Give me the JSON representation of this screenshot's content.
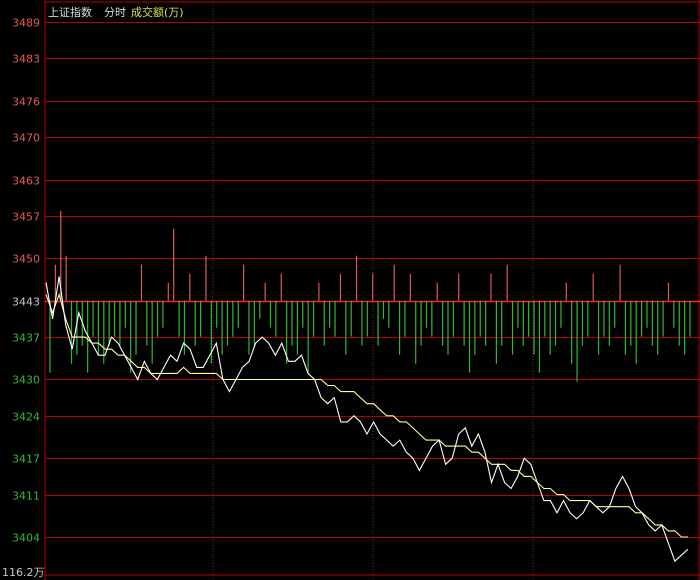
{
  "header": {
    "index_name": "上证指数",
    "mode": "分时",
    "series_label": "成交额(万)"
  },
  "colors": {
    "background": "#000000",
    "grid": "#b30000",
    "up": "#e05a5a",
    "down": "#33b833",
    "axis_neutral": "#c8c8c8",
    "price_line": "#ffffff",
    "avg_line": "#ffff99",
    "header_text": "#dcdcdc",
    "series_text": "#e0e050"
  },
  "chart_data": {
    "type": "line",
    "y_reference": 3443,
    "ylim": [
      3400,
      3490
    ],
    "y_ticks": [
      3489,
      3483,
      3476,
      3470,
      3463,
      3457,
      3450,
      3443,
      3437,
      3430,
      3424,
      3417,
      3411,
      3404
    ],
    "bottom_label": "116.2万",
    "grid": true,
    "series": [
      {
        "role": "price",
        "values": [
          3446,
          3440,
          3447,
          3439,
          3435,
          3441,
          3438,
          3436,
          3434,
          3434,
          3437,
          3436,
          3434,
          3432,
          3430,
          3433,
          3431,
          3430,
          3432,
          3434,
          3433,
          3436,
          3435,
          3432,
          3432,
          3434,
          3436,
          3430,
          3428,
          3430,
          3432,
          3433,
          3436,
          3437,
          3436,
          3434,
          3436,
          3433,
          3433,
          3434,
          3431,
          3430,
          3427,
          3426,
          3427,
          3423,
          3423,
          3424,
          3423,
          3421,
          3423,
          3421,
          3420,
          3419,
          3420,
          3418,
          3417,
          3415,
          3417,
          3419,
          3420,
          3416,
          3417,
          3421,
          3422,
          3419,
          3421,
          3418,
          3413,
          3416,
          3413,
          3412,
          3414,
          3417,
          3416,
          3413,
          3410,
          3410,
          3408,
          3410,
          3408,
          3407,
          3408,
          3410,
          3409,
          3408,
          3409,
          3412,
          3414,
          3412,
          3409,
          3408,
          3406,
          3405,
          3406,
          3403,
          3400,
          3401,
          3402
        ],
        "axis": "price"
      },
      {
        "role": "average",
        "values": [
          3444,
          3441,
          3444,
          3440,
          3437,
          3437,
          3437,
          3436,
          3436,
          3435,
          3435,
          3434,
          3434,
          3433,
          3432,
          3432,
          3431,
          3431,
          3431,
          3431,
          3431,
          3432,
          3431,
          3431,
          3431,
          3431,
          3431,
          3430,
          3430,
          3430,
          3430,
          3430,
          3430,
          3430,
          3430,
          3430,
          3430,
          3430,
          3430,
          3430,
          3430,
          3430,
          3430,
          3429,
          3429,
          3428,
          3428,
          3428,
          3427,
          3426,
          3426,
          3425,
          3424,
          3424,
          3423,
          3423,
          3422,
          3421,
          3420,
          3420,
          3420,
          3419,
          3419,
          3419,
          3419,
          3418,
          3418,
          3417,
          3416,
          3416,
          3416,
          3415,
          3415,
          3414,
          3414,
          3413,
          3412,
          3412,
          3411,
          3411,
          3410,
          3410,
          3410,
          3410,
          3409,
          3409,
          3409,
          3409,
          3409,
          3409,
          3408,
          3408,
          3407,
          3406,
          3406,
          3405,
          3405,
          3404,
          3404
        ],
        "axis": "price"
      },
      {
        "role": "turnover_bars",
        "values": [
          -8,
          4,
          10,
          5,
          -7,
          -6,
          -5,
          -8,
          -4,
          -6,
          -7,
          -5,
          -4,
          -5,
          -3,
          -8,
          -6,
          4,
          -5,
          -7,
          -4,
          -3,
          2,
          8,
          -4,
          -6,
          3,
          -5,
          -4,
          5,
          -7,
          -3,
          -6,
          -5,
          -4,
          -3,
          4,
          -6,
          -5,
          -2,
          2,
          -3,
          -4,
          3,
          -7,
          -5,
          -6,
          -3,
          -8,
          -4,
          2,
          -5,
          -3,
          -4,
          3,
          -6,
          -4,
          5,
          -5,
          -4,
          3,
          -5,
          -2,
          -3,
          4,
          -6,
          -4,
          3,
          -7,
          -5,
          -3,
          -4,
          2,
          -5,
          -6,
          -4,
          3,
          -5,
          -8,
          -6,
          -4,
          -5,
          3,
          -7,
          -5,
          4,
          -6,
          -3,
          -5,
          -4,
          -6,
          -8,
          -4,
          -6,
          -5,
          -3,
          2,
          -7,
          -9,
          -5,
          -4,
          3,
          -6,
          -4,
          -5,
          -3,
          4,
          -6,
          -5,
          -7,
          -4,
          -3,
          -5,
          -6,
          -4,
          2,
          -3,
          -5,
          -6,
          -4
        ],
        "axis": "turnover"
      }
    ]
  }
}
